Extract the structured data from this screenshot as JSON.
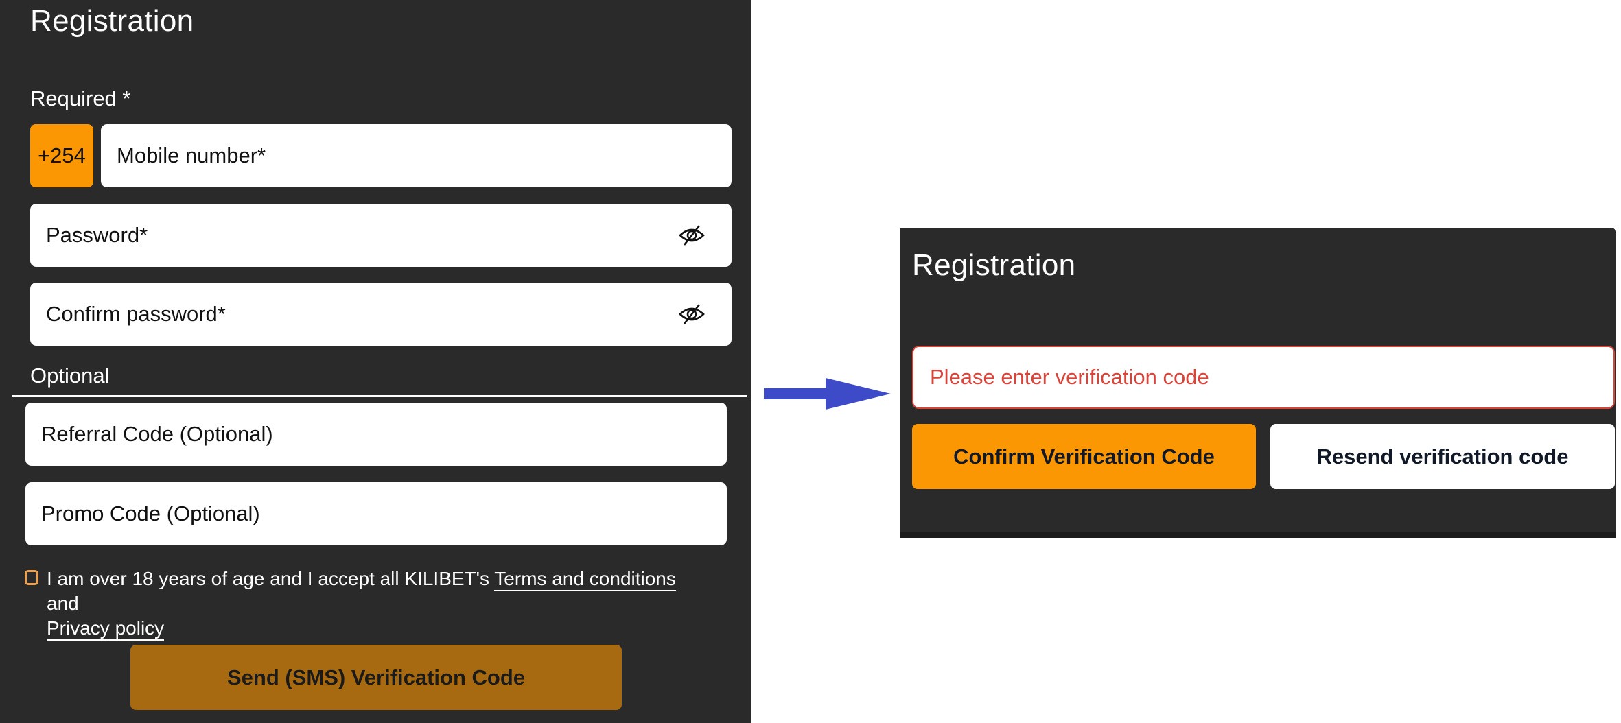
{
  "colors": {
    "panel_bg": "#2a2a2a",
    "accent_orange": "#fb9702",
    "disabled_orange": "#a86a10",
    "error_red": "#d9443a",
    "arrow_blue": "#3d4bc8"
  },
  "registration_form": {
    "title": "Registration",
    "required_label": "Required *",
    "country_code": "+254",
    "mobile_placeholder": "Mobile number*",
    "password_placeholder": "Password*",
    "confirm_password_placeholder": "Confirm password*",
    "password_toggle_icon": "eye-slash-icon",
    "optional_label": "Optional",
    "referral_placeholder": "Referral Code (Optional)",
    "promo_placeholder": "Promo Code (Optional)",
    "consent": {
      "checked": false,
      "text_before": "I am over 18 years of age and I accept all KILIBET's ",
      "terms_link": "Terms and conditions",
      "text_middle": " and ",
      "privacy_link": "Privacy policy"
    },
    "send_button": "Send (SMS) Verification Code"
  },
  "transition_arrow_icon": "arrow-right-icon",
  "verification_panel": {
    "title": "Registration",
    "code_placeholder": "Please enter verification code",
    "confirm_button": "Confirm Verification Code",
    "resend_button": "Resend verification code"
  }
}
